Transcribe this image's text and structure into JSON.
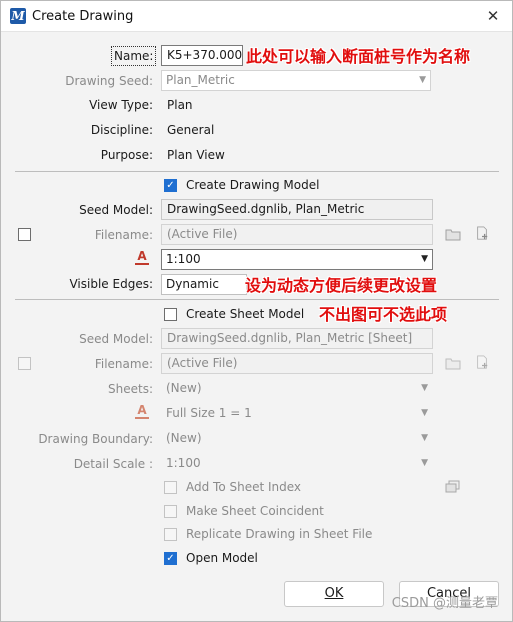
{
  "window": {
    "title": "Create Drawing"
  },
  "annotations": {
    "name_note": "此处可以输入断面桩号作为名称",
    "edges_note": "设为动态方便后续更改设置",
    "sheet_note": "不出图可不选此项"
  },
  "drawing": {
    "name_label": "Name:",
    "name_value": "K5+370.000",
    "seed_label": "Drawing Seed:",
    "seed_value": "Plan_Metric",
    "view_type_label": "View Type:",
    "view_type_value": "Plan",
    "discipline_label": "Discipline:",
    "discipline_value": "General",
    "purpose_label": "Purpose:",
    "purpose_value": "Plan View"
  },
  "drawing_model": {
    "checkbox_label": "Create Drawing Model",
    "checked": true,
    "seed_model_label": "Seed Model:",
    "seed_model_value": "DrawingSeed.dgnlib, Plan_Metric",
    "filename_label": "Filename:",
    "filename_value": "(Active File)",
    "scale_value": "1:100",
    "visible_edges_label": "Visible Edges:",
    "visible_edges_value": "Dynamic"
  },
  "sheet_model": {
    "checkbox_label": "Create Sheet Model",
    "checked": false,
    "seed_model_label": "Seed Model:",
    "seed_model_value": "DrawingSeed.dgnlib, Plan_Metric [Sheet]",
    "filename_label": "Filename:",
    "filename_value": "(Active File)",
    "sheets_label": "Sheets:",
    "sheets_value": "(New)",
    "size_value": "Full Size 1 = 1",
    "boundary_label": "Drawing Boundary:",
    "boundary_value": "(New)",
    "detail_scale_label": "Detail Scale :",
    "detail_scale_value": "1:100",
    "add_to_index_label": "Add To Sheet Index",
    "make_coincident_label": "Make Sheet Coincident",
    "replicate_label": "Replicate Drawing in Sheet File"
  },
  "open_model": {
    "label": "Open Model",
    "checked": true
  },
  "buttons": {
    "ok": "OK",
    "cancel": "Cancel"
  },
  "watermark": "CSDN @测量老覃",
  "icons": {
    "app": "microstation-icon",
    "close": "close-icon",
    "folder": "folder-icon",
    "new_file": "new-file-icon",
    "scale": "annotation-scale-icon",
    "sheet_index": "sheet-index-icon"
  }
}
